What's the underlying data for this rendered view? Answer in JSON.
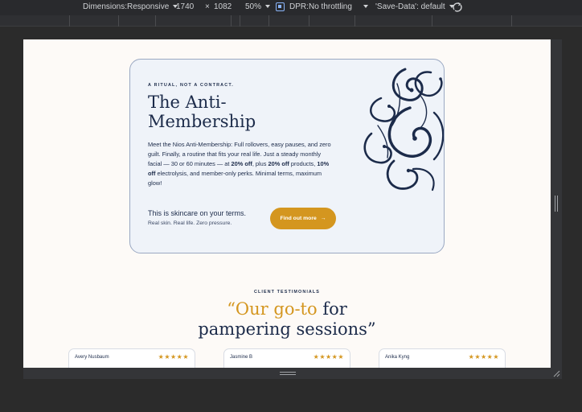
{
  "toolbar": {
    "dimensions_label": "Dimensions:",
    "device": "Responsive",
    "width": "1740",
    "times": "×",
    "height": "1082",
    "zoom": "50%",
    "dpr": "DPR:",
    "throttling": "No throttling",
    "save_data": "'Save-Data': default"
  },
  "hero": {
    "eyebrow": "A RITUAL, NOT A CONTRACT.",
    "title": "The Anti-Membership",
    "body_1": "Meet the Nios Anti-Membership: Full rollovers, easy pauses, and zero guilt. Finally, a routine that fits your real life. Just a steady monthly facial — 30 or 60 minutes — at ",
    "body_b1": "20% off",
    "body_2": ", plus ",
    "body_b2": "20% off",
    "body_3": " products, ",
    "body_b3": "10% off",
    "body_4": " electrolysis, and member-only perks. Minimal terms, maximum glow!",
    "tagline": "This is skincare on your terms.",
    "subtag": "Real skin. Real life. Zero pressure.",
    "cta_label": "Find out more",
    "cta_arrow": "→"
  },
  "testimonials": {
    "eyebrow": "CLIENT TESTIMONIALS",
    "headline_gold": "“Our go-to",
    "headline_rest": " for",
    "headline_line2": "pampering sessions”",
    "cards": [
      {
        "name": "Avery Nusbaum",
        "stars": "★★★★★"
      },
      {
        "name": "Jasmine B",
        "stars": "★★★★★"
      },
      {
        "name": "Anika Kyng",
        "stars": "★★★★★"
      }
    ]
  },
  "colors": {
    "navy": "#1c2b4a",
    "gold": "#d4961f",
    "card_bg": "#eff3f9",
    "page_bg": "#fdfaf7"
  }
}
